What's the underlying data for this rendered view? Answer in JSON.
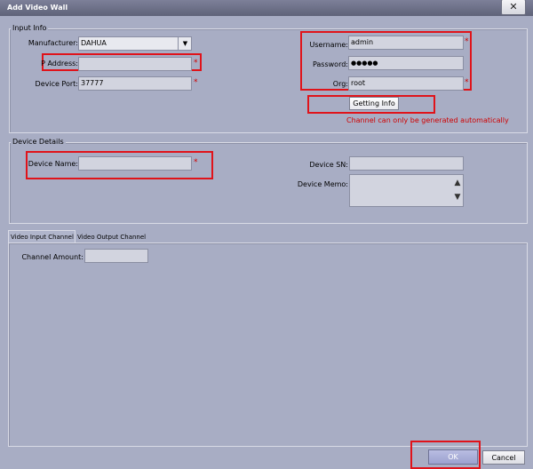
{
  "window": {
    "title": "Add Video Wall",
    "close_glyph": "✕"
  },
  "input_info": {
    "legend": "Input Info",
    "manufacturer_label": "Manufacturer:",
    "manufacturer_value": "DAHUA",
    "dropdown_glyph": "▼",
    "ip_label": "P Address:",
    "ip_value": "",
    "port_label": "Device Port:",
    "port_value": "37777",
    "username_label": "Username:",
    "username_value": "admin",
    "password_label": "Password:",
    "password_value": "●●●●●",
    "org_label": "Org:",
    "org_value": "root",
    "required_mark": "*",
    "getting_info_label": "Getting Info",
    "channel_notice": "Channel can only be generated automatically"
  },
  "device_details": {
    "legend": "Device Details",
    "name_label": "Device Name:",
    "name_value": "",
    "sn_label": "Device SN:",
    "sn_value": "",
    "memo_label": "Device Memo:",
    "memo_value": "",
    "scroll_up": "▲",
    "scroll_down": "▼"
  },
  "tabs": [
    {
      "label": "Video Input Channel"
    },
    {
      "label": "Video Output Channel"
    }
  ],
  "channel": {
    "amount_label": "Channel Amount:",
    "amount_value": ""
  },
  "footer": {
    "ok_label": "OK",
    "cancel_label": "Cancel"
  },
  "colors": {
    "background": "#a8adc4",
    "highlight": "#e0131a",
    "notice": "#d00000"
  }
}
